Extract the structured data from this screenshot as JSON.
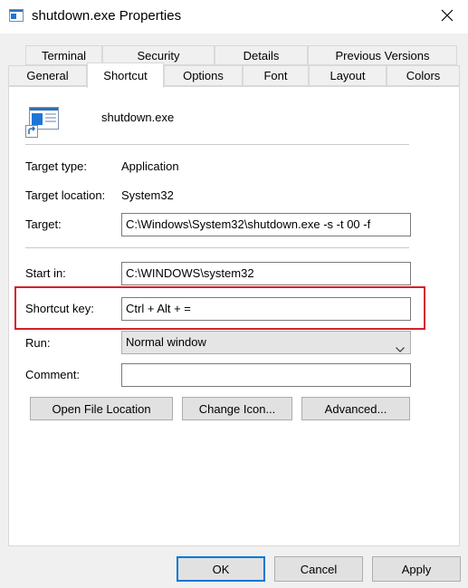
{
  "window": {
    "title": "shutdown.exe Properties"
  },
  "tabs": {
    "row1": [
      "Terminal",
      "Security",
      "Details",
      "Previous Versions"
    ],
    "row2": [
      "General",
      "Shortcut",
      "Options",
      "Font",
      "Layout",
      "Colors"
    ],
    "active": "Shortcut"
  },
  "shortcut": {
    "name": "shutdown.exe",
    "target_type_label": "Target type:",
    "target_type_value": "Application",
    "target_location_label": "Target location:",
    "target_location_value": "System32",
    "target_label": "Target:",
    "target_value": "C:\\Windows\\System32\\shutdown.exe -s -t 00 -f",
    "start_in_label": "Start in:",
    "start_in_value": "C:\\WINDOWS\\system32",
    "shortcut_key_label": "Shortcut key:",
    "shortcut_key_value": "Ctrl + Alt + =",
    "run_label": "Run:",
    "run_value": "Normal window",
    "comment_label": "Comment:",
    "comment_value": ""
  },
  "panel_buttons": {
    "open_file_location": "Open File Location",
    "change_icon": "Change Icon...",
    "advanced": "Advanced..."
  },
  "dialog_buttons": {
    "ok": "OK",
    "cancel": "Cancel",
    "apply": "Apply"
  },
  "colors": {
    "highlight": "#d6202a",
    "focus": "#0078d7"
  },
  "icons": {
    "title": "shortcut-app-icon",
    "close": "close-icon",
    "dropdown": "chevron-down-icon"
  }
}
